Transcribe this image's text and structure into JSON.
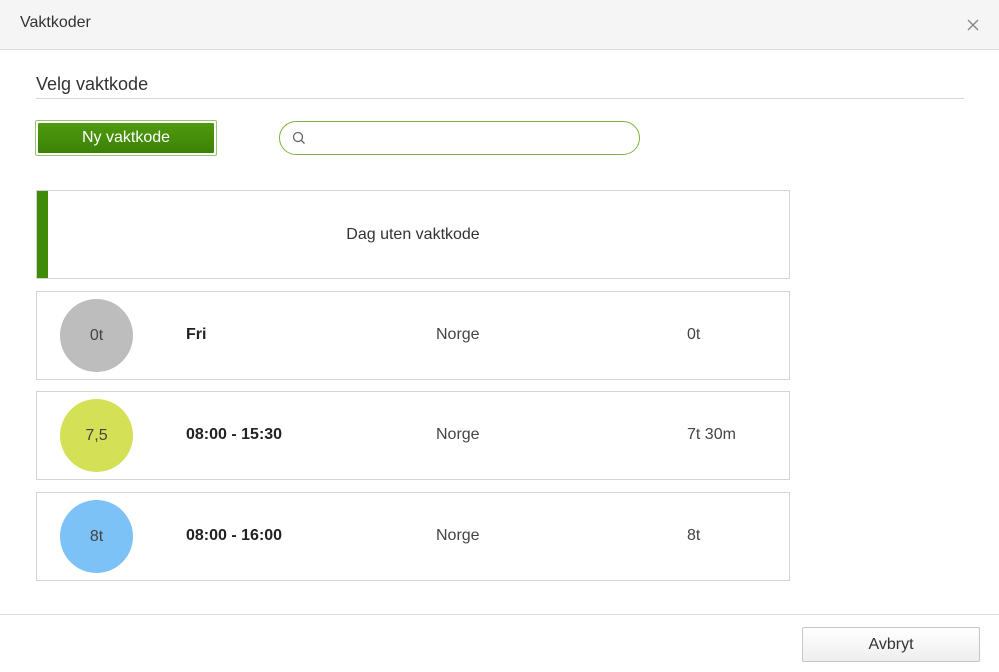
{
  "dialog": {
    "title": "Vaktkoder",
    "close_icon": "close-icon"
  },
  "section": {
    "title": "Velg vaktkode"
  },
  "toolbar": {
    "new_button_label": "Ny vaktkode",
    "search_icon": "search-icon",
    "search_value": "",
    "search_placeholder": ""
  },
  "no_code": {
    "label": "Dag uten vaktkode",
    "accent_color": "#3f8a06"
  },
  "shifts": [
    {
      "badge": "0t",
      "badge_color": "#bdbdbd",
      "name": "Fri",
      "country": "Norge",
      "hours": "0t"
    },
    {
      "badge": "7,5",
      "badge_color": "#d4e157",
      "name": "08:00 - 15:30",
      "country": "Norge",
      "hours": "7t 30m"
    },
    {
      "badge": "8t",
      "badge_color": "#7cc2f7",
      "name": "08:00 - 16:00",
      "country": "Norge",
      "hours": "8t"
    }
  ],
  "footer": {
    "cancel_label": "Avbryt"
  }
}
